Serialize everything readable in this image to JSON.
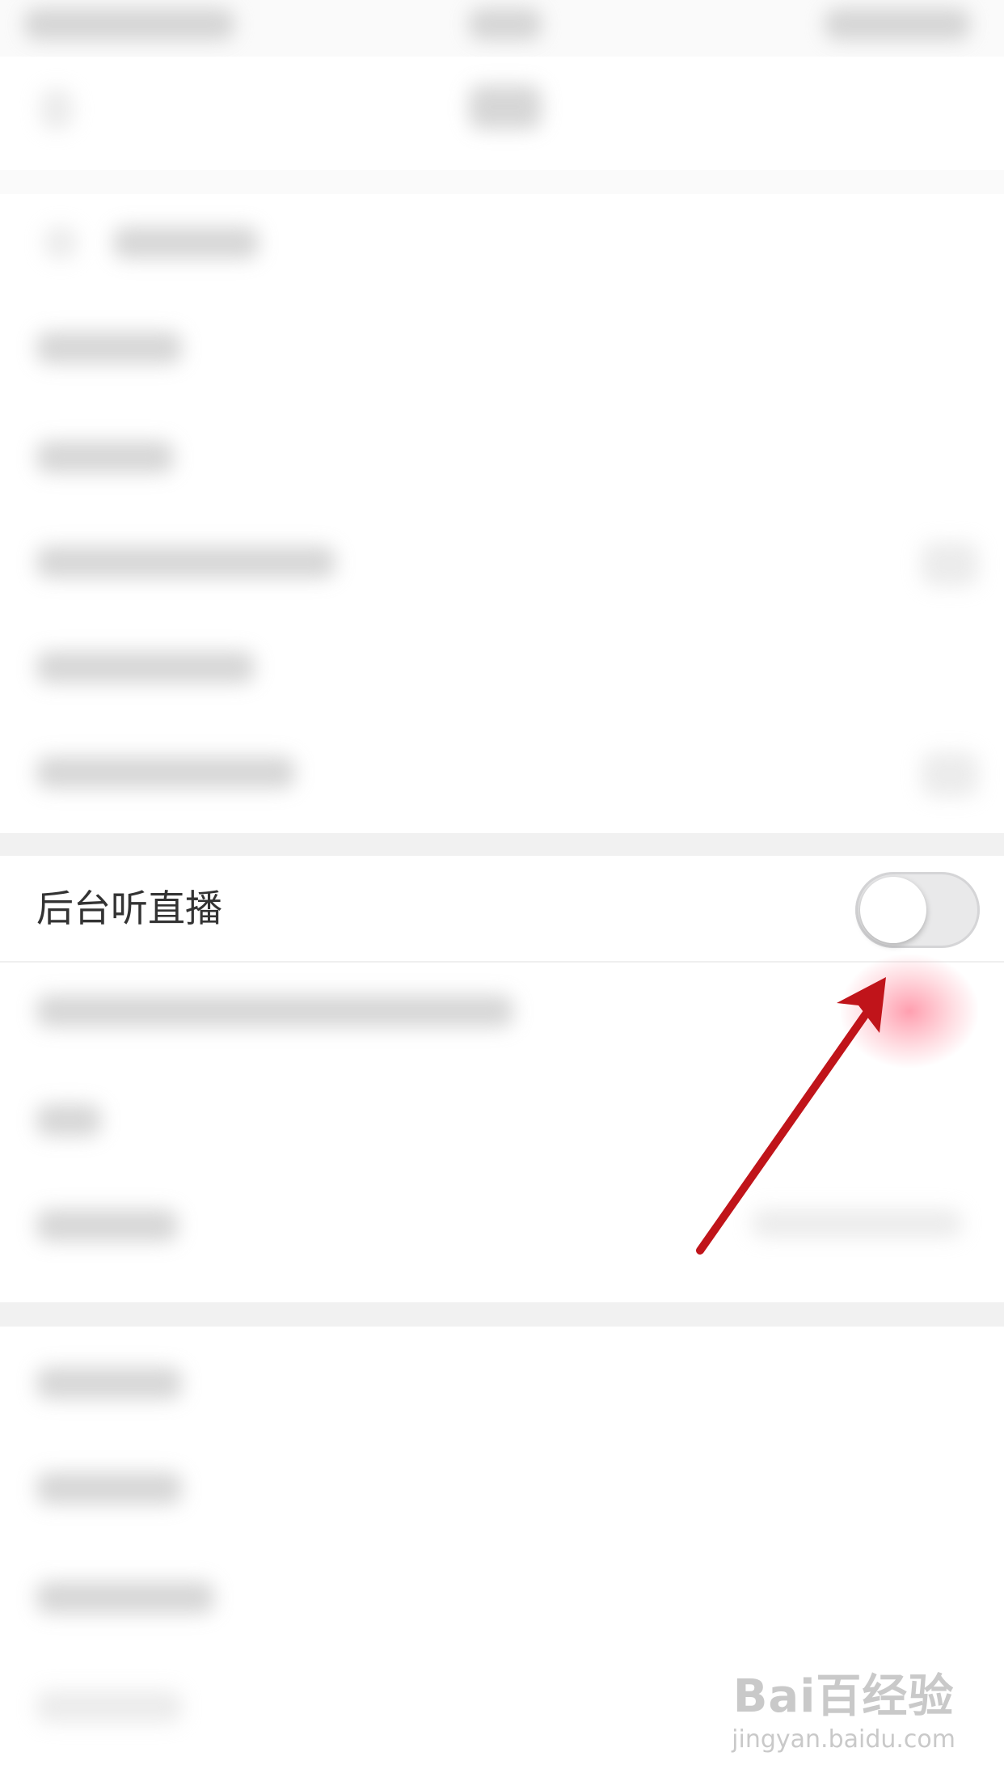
{
  "settings": {
    "background_listen_live": {
      "label": "后台听直播",
      "enabled": false
    }
  },
  "watermark": {
    "logo": "Bai百经验",
    "url": "jingyan.baidu.com"
  },
  "colors": {
    "arrow": "#c0141a",
    "toggle_off": "#e9e9ea"
  }
}
